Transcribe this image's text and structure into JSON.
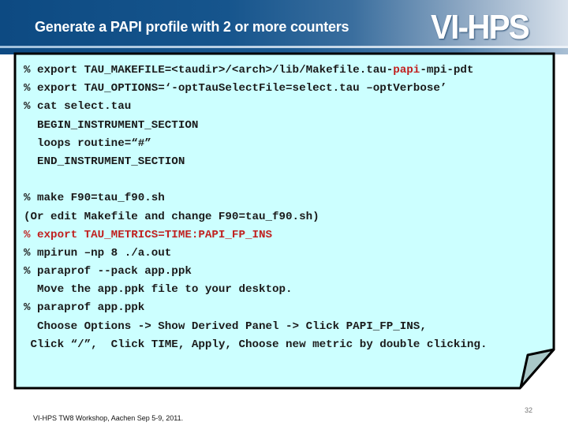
{
  "header": {
    "title": "Generate a PAPI profile with 2 or more counters",
    "logo": "VI-HPS"
  },
  "note": {
    "lines": [
      {
        "prefix": "% export TAU_MAKEFILE=<taudir>/<arch>/lib/Makefile.tau-",
        "highlight": "papi",
        "suffix": "-mpi-pdt",
        "color": "default"
      },
      {
        "prefix": "% export TAU_OPTIONS=‘-optTauSelectFile=select.tau –optVerbose’",
        "highlight": "",
        "suffix": "",
        "color": "default"
      },
      {
        "prefix": "% cat select.tau",
        "highlight": "",
        "suffix": "",
        "color": "default"
      },
      {
        "prefix": "  BEGIN_INSTRUMENT_SECTION",
        "highlight": "",
        "suffix": "",
        "color": "default"
      },
      {
        "prefix": "  loops routine=“#”",
        "highlight": "",
        "suffix": "",
        "color": "default"
      },
      {
        "prefix": "  END_INSTRUMENT_SECTION",
        "highlight": "",
        "suffix": "",
        "color": "default"
      },
      {
        "prefix": "",
        "highlight": "",
        "suffix": "",
        "color": "default"
      },
      {
        "prefix": "% make F90=tau_f90.sh",
        "highlight": "",
        "suffix": "",
        "color": "default"
      },
      {
        "prefix": "(Or edit Makefile and change F90=tau_f90.sh)",
        "highlight": "",
        "suffix": "",
        "color": "default"
      },
      {
        "prefix": "",
        "highlight": "% export TAU_METRICS=TIME:PAPI_FP_INS",
        "suffix": "",
        "color": "red"
      },
      {
        "prefix": "% mpirun –np 8 ./a.out",
        "highlight": "",
        "suffix": "",
        "color": "default"
      },
      {
        "prefix": "% paraprof --pack app.ppk",
        "highlight": "",
        "suffix": "",
        "color": "default"
      },
      {
        "prefix": "  Move the app.ppk file to your desktop.",
        "highlight": "",
        "suffix": "",
        "color": "default"
      },
      {
        "prefix": "% paraprof app.ppk",
        "highlight": "",
        "suffix": "",
        "color": "default"
      },
      {
        "prefix": "  Choose Options -> Show Derived Panel -> Click PAPI_FP_INS,",
        "highlight": "",
        "suffix": "",
        "color": "default"
      },
      {
        "prefix": " Click “/”,  Click TIME, Apply, Choose new metric by double clicking.",
        "highlight": "",
        "suffix": "",
        "color": "default"
      }
    ],
    "colors": {
      "background": "#ccffff",
      "border": "#000000",
      "fold": "#a9c8c8",
      "highlight": "#c0201f"
    }
  },
  "footer": {
    "text": "VI-HPS TW8 Workshop, Aachen Sep 5-9, 2011.",
    "page_number": "32"
  }
}
